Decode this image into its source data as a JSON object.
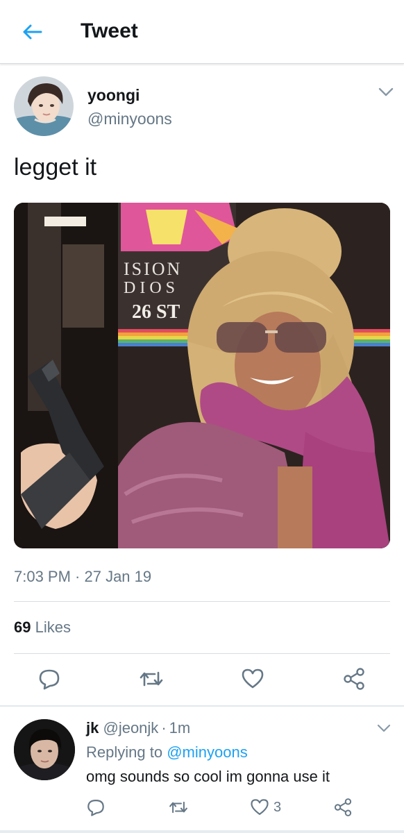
{
  "header": {
    "title": "Tweet",
    "back_icon": "arrow-left-icon",
    "accent": "#1da1f2"
  },
  "tweet": {
    "author_name": "yoongi",
    "author_handle": "@minyoons",
    "text": "legget it",
    "media_sign": {
      "line1": "ISION",
      "line2": "DIOS",
      "line3": "26 ST"
    },
    "timestamp": "7:03 PM · 27 Jan 19",
    "likes_count": "69",
    "likes_label": "Likes",
    "actions": [
      "reply-icon",
      "retweet-icon",
      "like-icon",
      "share-icon"
    ]
  },
  "reply": {
    "author_name": "jk",
    "author_handle": "@jeonjk",
    "separator": "·",
    "time": "1m",
    "replying_prefix": "Replying to",
    "replying_mention": "@minyoons",
    "text": "omg sounds so cool im gonna use it",
    "like_count": "3",
    "actions": [
      "reply-icon",
      "retweet-icon",
      "like-icon",
      "share-icon"
    ]
  },
  "colors": {
    "text": "#14171a",
    "secondary": "#657786",
    "link": "#1da1f2",
    "divider": "#d9dee2"
  }
}
